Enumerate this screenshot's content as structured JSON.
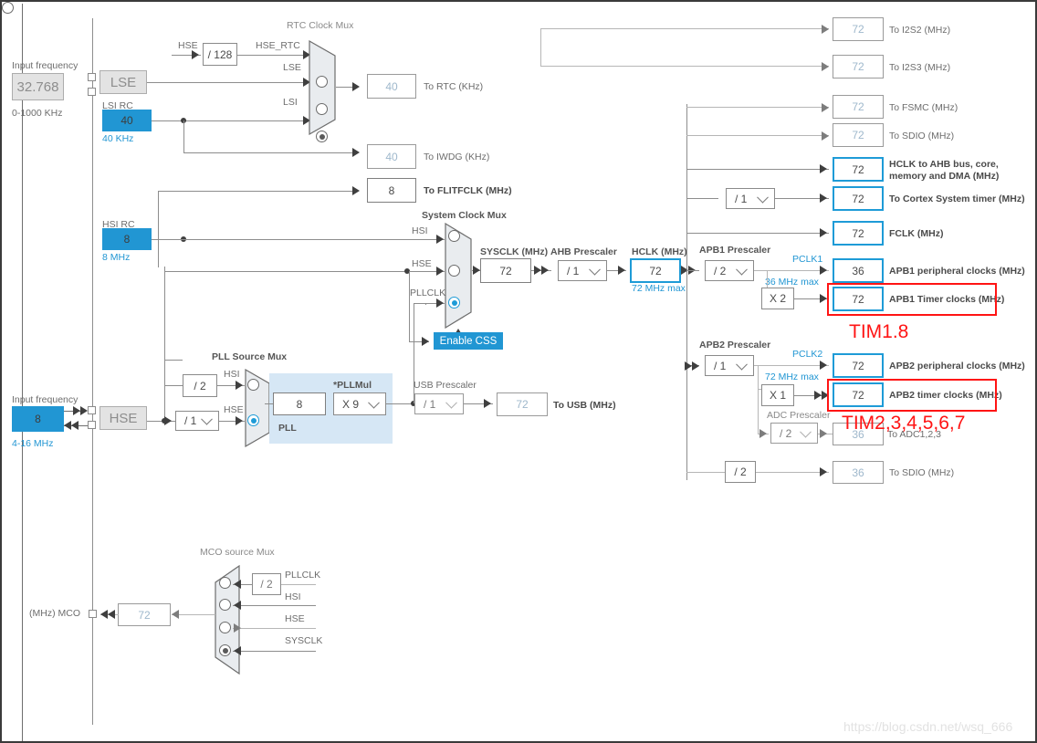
{
  "oscillators": {
    "lse": {
      "input_frequency_label": "Input frequency",
      "value": "32.768",
      "range": "0-1000 KHz",
      "name": "LSE"
    },
    "lsi": {
      "title": "LSI RC",
      "value": "40",
      "unit": "40 KHz"
    },
    "hsi": {
      "title": "HSI RC",
      "value": "8",
      "unit": "8 MHz"
    },
    "hse": {
      "input_frequency_label": "Input frequency",
      "value": "8",
      "range": "4-16 MHz",
      "name": "HSE"
    }
  },
  "rtc_mux": {
    "title": "RTC Clock Mux",
    "hse_label": "HSE",
    "divider": "/ 128",
    "inputs": [
      "HSE_RTC",
      "LSE",
      "LSI"
    ],
    "selected_index": 2
  },
  "system_clock_mux": {
    "title": "System Clock Mux",
    "inputs": [
      "HSI",
      "HSE",
      "PLLCLK"
    ],
    "selected_index": 2,
    "css_button": "Enable CSS"
  },
  "pll": {
    "source_mux_title": "PLL Source Mux",
    "inputs": [
      "HSI",
      "HSE"
    ],
    "selected_index": 1,
    "hsi_divider": "/ 2",
    "hse_divider": "/ 1",
    "panel_label": "PLL",
    "input_value": "8",
    "pllmul_label": "*PLLMul",
    "pllmul_value": "X 9"
  },
  "mco_mux": {
    "title": "MCO source Mux",
    "inputs": [
      "PLLCLK",
      "HSI",
      "HSE",
      "SYSCLK"
    ],
    "selected_index": 3,
    "pllclk_divider": "/ 2",
    "output_value": "72",
    "output_label": "(MHz) MCO"
  },
  "core_chain": {
    "sysclk_label": "SYSCLK (MHz)",
    "sysclk_value": "72",
    "ahb_prescaler_label": "AHB Prescaler",
    "ahb_prescaler_value": "/ 1",
    "hclk_label": "HCLK (MHz)",
    "hclk_value": "72",
    "hclk_max": "72 MHz max"
  },
  "usb": {
    "prescaler_label": "USB Prescaler",
    "prescaler_value": "/ 1",
    "value": "72",
    "label": "To USB (MHz)"
  },
  "outputs": [
    {
      "value": "72",
      "label": "To I2S2 (MHz)",
      "style": "grey"
    },
    {
      "value": "72",
      "label": "To I2S3 (MHz)",
      "style": "grey"
    },
    {
      "value": "72",
      "label": "To FSMC (MHz)",
      "style": "grey"
    },
    {
      "value": "72",
      "label": "To SDIO (MHz)",
      "style": "grey"
    },
    {
      "value": "72",
      "label": "HCLK to AHB bus, core, memory and DMA (MHz)",
      "style": "blue"
    },
    {
      "value": "72",
      "label": "To Cortex System timer (MHz)",
      "style": "blue"
    },
    {
      "value": "72",
      "label": "FCLK (MHz)",
      "style": "blue"
    }
  ],
  "cortex_prescaler_value": "/ 1",
  "flitfclk": {
    "value": "8",
    "label": "To FLITFCLK (MHz)"
  },
  "rtc_out": {
    "value": "40",
    "label": "To RTC (KHz)"
  },
  "iwdg_out": {
    "value": "40",
    "label": "To IWDG (KHz)"
  },
  "apb1": {
    "prescaler_label": "APB1 Prescaler",
    "prescaler_value": "/ 2",
    "pclk_label": "PCLK1",
    "max_label": "36 MHz max",
    "peripheral_value": "36",
    "peripheral_label": "APB1 peripheral clocks (MHz)",
    "multiplier": "X 2",
    "timer_value": "72",
    "timer_label": "APB1 Timer clocks (MHz)"
  },
  "apb2": {
    "prescaler_label": "APB2 Prescaler",
    "prescaler_value": "/ 1",
    "pclk_label": "PCLK2",
    "max_label": "72 MHz max",
    "peripheral_value": "72",
    "peripheral_label": "APB2 peripheral clocks (MHz)",
    "multiplier": "X 1",
    "timer_value": "72",
    "timer_label": "APB2 timer clocks (MHz)",
    "adc_prescaler_label": "ADC Prescaler",
    "adc_prescaler_value": "/ 2",
    "adc_value": "36",
    "adc_label": "To ADC1,2,3"
  },
  "sdio_bottom": {
    "divider": "/ 2",
    "value": "36",
    "label": "To SDIO (MHz)"
  },
  "annotations": [
    {
      "text": "TIM1.8",
      "color": "#ff1414"
    },
    {
      "text": "TIM2,3,4,5,6,7",
      "color": "#ff1414"
    }
  ],
  "watermark": "https://blog.csdn.net/wsq_666",
  "colors": {
    "accent_blue": "#2196d3",
    "annotation_red": "#ff1414",
    "line_grey": "#8d8d8d"
  }
}
